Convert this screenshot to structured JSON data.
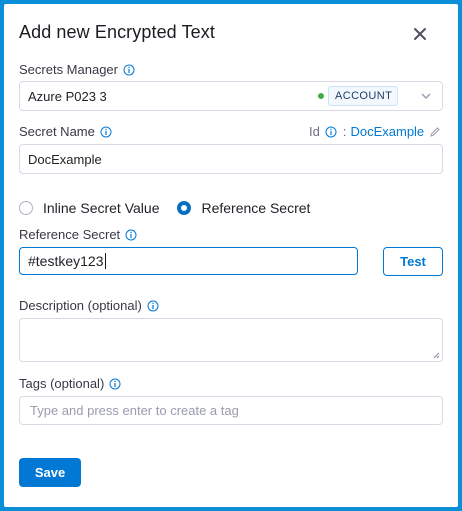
{
  "dialog": {
    "title": "Add new Encrypted Text"
  },
  "secrets_manager": {
    "label": "Secrets Manager",
    "value": "Azure P023 3",
    "scope_badge": "ACCOUNT",
    "status_color": "#42ab45"
  },
  "secret_name": {
    "label": "Secret Name",
    "value": "DocExample",
    "id_label": "Id",
    "id_value": "DocExample"
  },
  "value_type": {
    "options": [
      "Inline Secret Value",
      "Reference Secret"
    ],
    "selected": "Reference Secret"
  },
  "reference_secret": {
    "label": "Reference Secret",
    "value": "#testkey123",
    "test_label": "Test"
  },
  "description": {
    "label": "Description (optional)",
    "value": ""
  },
  "tags": {
    "label": "Tags (optional)",
    "placeholder": "Type and press enter to create a tag"
  },
  "actions": {
    "save_label": "Save"
  },
  "colors": {
    "accent": "#0278d5",
    "frame": "#0a8fd8"
  }
}
